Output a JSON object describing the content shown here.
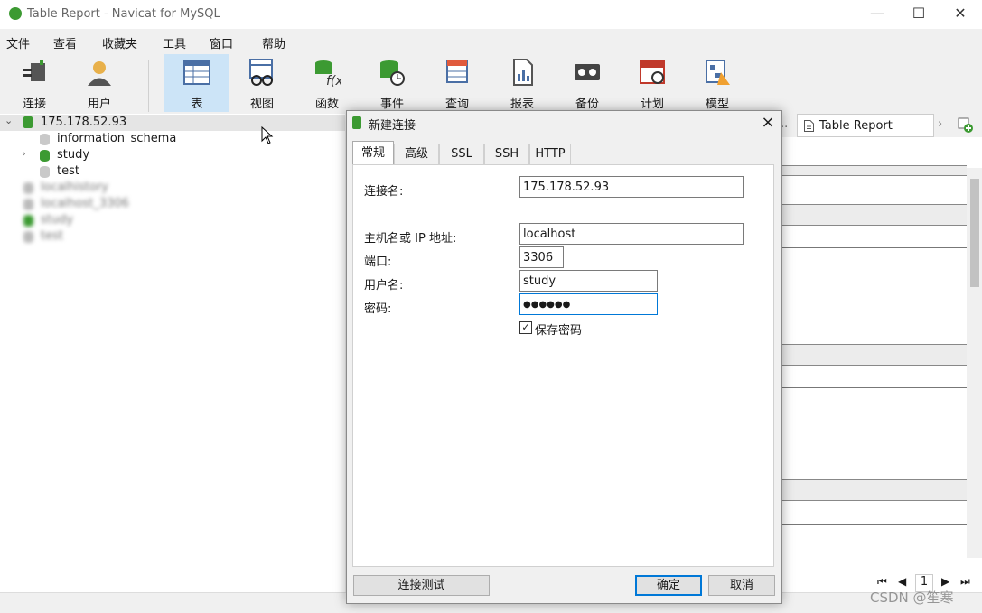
{
  "window": {
    "title": "Table Report - Navicat for MySQL",
    "minimize": "—",
    "maximize": "☐",
    "close": "✕"
  },
  "menu": [
    "文件",
    "查看",
    "收藏夹",
    "工具",
    "窗口",
    "帮助"
  ],
  "toolbar": [
    "连接",
    "用户",
    "表",
    "视图",
    "函数",
    "事件",
    "查询",
    "报表",
    "备份",
    "计划",
    "模型"
  ],
  "toolbar_active": "表",
  "tree": {
    "connection": "175.178.52.93",
    "databases": [
      "information_schema",
      "study",
      "test"
    ],
    "blurred": [
      "localhistory",
      "localhost_3306",
      "study",
      "test"
    ]
  },
  "right_tabs": {
    "report_tab": "Table Report"
  },
  "dialog": {
    "title": "新建连接",
    "tabs": [
      "常规",
      "高级",
      "SSL",
      "SSH",
      "HTTP"
    ],
    "fields": {
      "connection_name_label": "连接名:",
      "connection_name_value": "175.178.52.93",
      "host_label": "主机名或 IP 地址:",
      "host_value": "localhost",
      "port_label": "端口:",
      "port_value": "3306",
      "user_label": "用户名:",
      "user_value": "study",
      "password_label": "密码:",
      "password_value": "●●●●●●",
      "save_password_label": "保存密码"
    },
    "buttons": {
      "test": "连接测试",
      "ok": "确定",
      "cancel": "取消"
    }
  },
  "pager": {
    "page": "1"
  },
  "watermark": "CSDN @笙寒"
}
